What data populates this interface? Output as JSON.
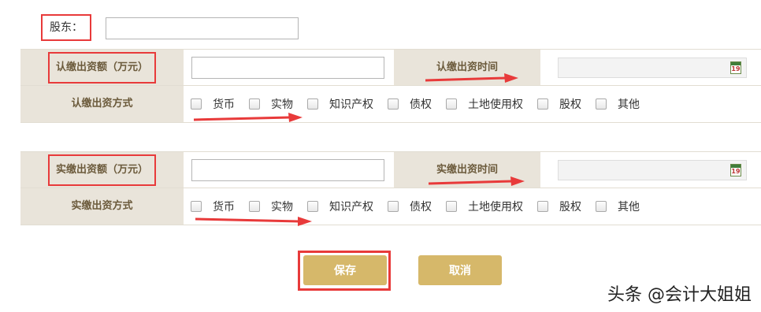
{
  "shareholder": {
    "label": "股东："
  },
  "subscribed": {
    "amount_label": "认缴出资额（万元）",
    "time_label": "认缴出资时间",
    "method_label": "认缴出资方式",
    "calendar_day": "19"
  },
  "paid": {
    "amount_label": "实缴出资额（万元）",
    "time_label": "实缴出资时间",
    "method_label": "实缴出资方式",
    "calendar_day": "19"
  },
  "methods": [
    "货币",
    "实物",
    "知识产权",
    "债权",
    "土地使用权",
    "股权",
    "其他"
  ],
  "buttons": {
    "save": "保存",
    "cancel": "取消"
  },
  "watermark": "头条 @会计大姐姐",
  "colors": {
    "accent": "#d6b86a",
    "highlight": "#e83a3a",
    "label_bg": "#e9e4da"
  }
}
